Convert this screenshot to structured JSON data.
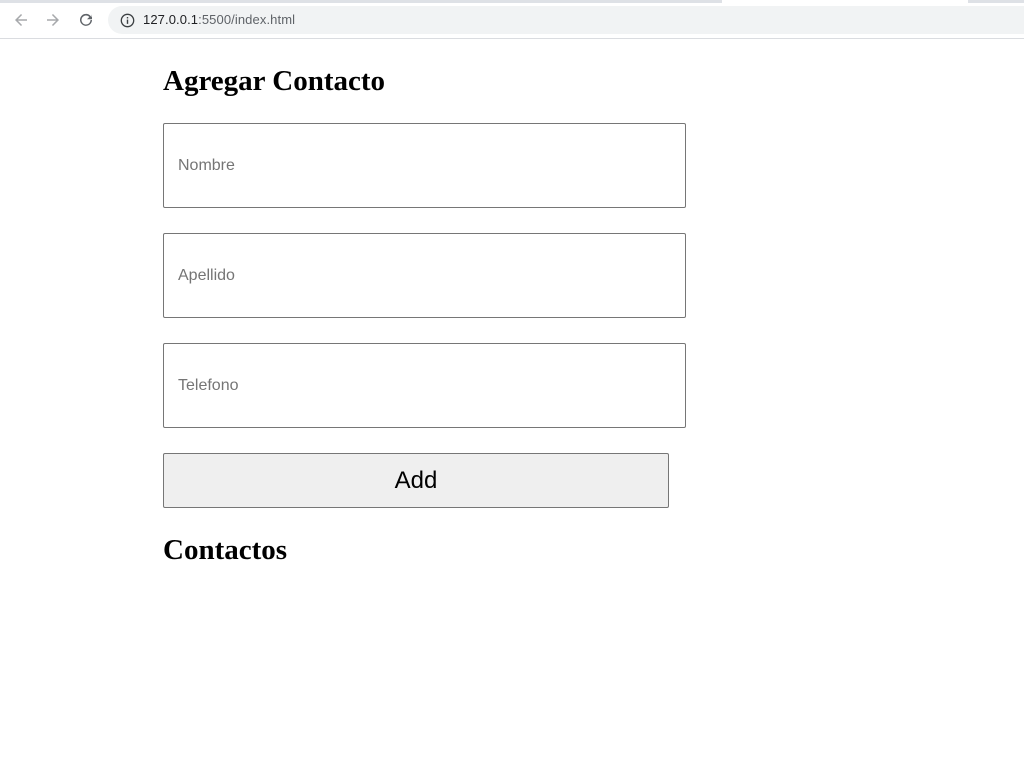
{
  "browser": {
    "back_icon": "arrow-left-icon",
    "forward_icon": "arrow-right-icon",
    "reload_icon": "reload-icon",
    "site_info_icon": "info-icon",
    "url_host": "127.0.0.1",
    "url_path": ":5500/index.html"
  },
  "form": {
    "title": "Agregar Contacto",
    "nombre_placeholder": "Nombre",
    "nombre_value": "",
    "apellido_placeholder": "Apellido",
    "apellido_value": "",
    "telefono_placeholder": "Telefono",
    "telefono_value": "",
    "add_label": "Add"
  },
  "contacts": {
    "title": "Contactos",
    "items": []
  },
  "colors": {
    "input_border": "#767676",
    "button_bg": "#efefef",
    "placeholder": "#757575",
    "omnibox_bg": "#f1f3f4"
  }
}
